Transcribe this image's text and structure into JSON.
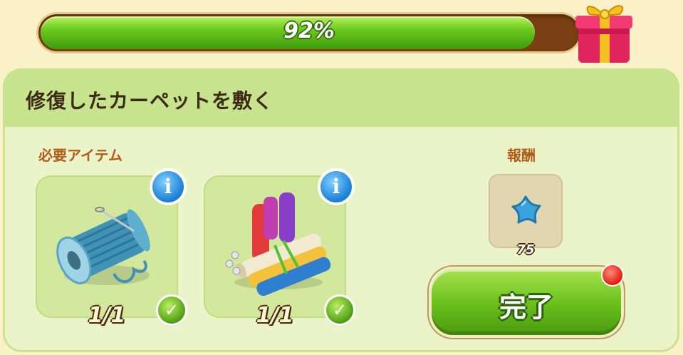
{
  "progress": {
    "percent_text": "92%",
    "value": 0.92
  },
  "task": {
    "title": "修復したカーペットを敷く"
  },
  "required": {
    "label": "必要アイテム",
    "items": [
      {
        "name": "thread-spool",
        "count": "1/1",
        "done": true
      },
      {
        "name": "fabric-rolls",
        "count": "1/1",
        "done": true
      }
    ]
  },
  "reward": {
    "label": "報酬",
    "icon": "blue-star-icon",
    "amount": "75"
  },
  "complete_button": {
    "label": "完了"
  },
  "icons": {
    "info": "i",
    "check": "✓"
  },
  "colors": {
    "accent_green": "#6cc21d",
    "info_blue": "#1a7ed6",
    "notify_red": "#e21b10"
  }
}
